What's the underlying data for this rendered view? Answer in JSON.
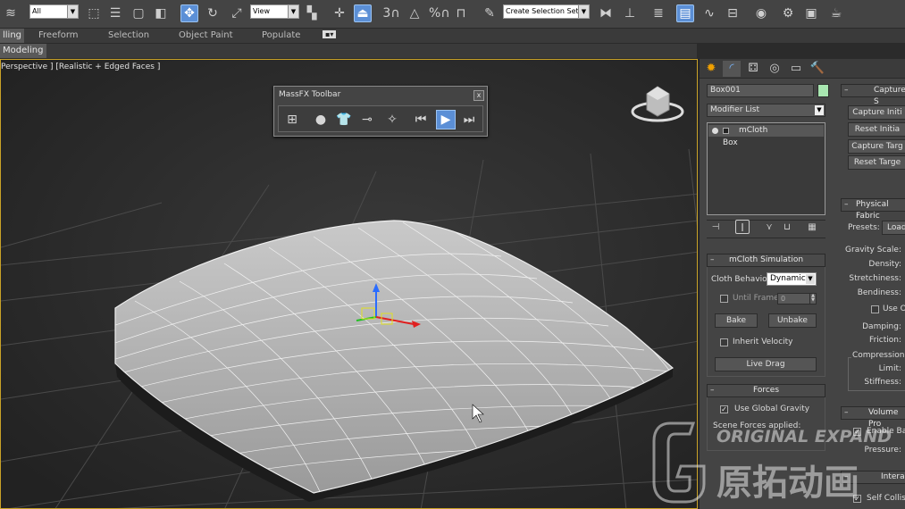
{
  "toolbar": {
    "selection_filter": "All",
    "reference_coord": "View",
    "named_selection_placeholder": "Create Selection Set",
    "snap_toggle_label": "3",
    "percent_snap_label": "%",
    "icons": [
      "undo-redo-icon",
      "select-object-icon",
      "select-by-name-icon",
      "rect-region-icon",
      "window-crossing-icon",
      "move-icon",
      "rotate-icon",
      "scale-icon",
      "select-manipulate-icon",
      "keyboard-shortcut-icon",
      "pivot-icon",
      "snap-icon",
      "angle-snap-icon",
      "percent-snap-icon",
      "spinner-snap-icon",
      "edit-named-selection-icon",
      "mirror-icon",
      "align-icon",
      "layer-manager-icon",
      "scene-explorer-icon",
      "curve-editor-icon",
      "schematic-view-icon",
      "material-editor-icon",
      "render-setup-icon",
      "rendered-frame-icon",
      "render-icon"
    ]
  },
  "ribbon": {
    "tabs": [
      "lling",
      "Freeform",
      "Selection",
      "Object Paint",
      "Populate"
    ],
    "sub_tab": "Modeling"
  },
  "viewport": {
    "label": "Perspective ] [Realistic + Edged Faces ]"
  },
  "massfx": {
    "title": "MassFX Toolbar",
    "close": "x",
    "buttons": [
      "world-params-icon",
      "rigid-body-icon",
      "mcloth-icon",
      "constraint-icon",
      "ragdoll-icon",
      "reset-simulation-icon",
      "play-simulation-icon",
      "step-simulation-icon"
    ]
  },
  "command_panel": {
    "tabs": [
      "create-icon",
      "modify-icon",
      "hierarchy-icon",
      "motion-icon",
      "display-icon",
      "utilities-icon"
    ],
    "object_name": "Box001",
    "object_color": "#a8e6b0",
    "modifier_list": "Modifier List",
    "stack": [
      "mCloth",
      "Box"
    ],
    "mcloth_simulation": {
      "title": "mCloth Simulation",
      "cloth_behavior_label": "Cloth Behavior:",
      "cloth_behavior_value": "Dynamic",
      "until_frame_label": "Until Frame",
      "until_frame_value": "0",
      "bake": "Bake",
      "unbake": "Unbake",
      "inherit_velocity": "Inherit Velocity",
      "live_drag": "Live Drag"
    },
    "forces": {
      "title": "Forces",
      "use_global_gravity": "Use Global Gravity",
      "scene_forces_applied": "Scene Forces applied:"
    },
    "capture": {
      "title": "Capture S",
      "buttons": [
        "Capture Initi",
        "Reset Initia",
        "Capture Targ",
        "Reset Targe"
      ]
    },
    "physical_fabric": {
      "title": "Physical Fabric",
      "presets_label": "Presets:",
      "presets_button": "Load",
      "rows": [
        "Gravity Scale:",
        "Density:",
        "Stretchiness:",
        "Bendiness:"
      ],
      "use_label": "Use Or",
      "rows2": [
        "Damping:",
        "Friction:"
      ],
      "compression_group": "Compression",
      "rows3": [
        "Limit:",
        "Stiffness:"
      ]
    },
    "volume": {
      "title": "Volume Pro",
      "enable_label": "Enable Ball",
      "pressure_label": "Pressure:"
    },
    "interaction": {
      "title": "Interac",
      "self_collision": "Self Collisi"
    }
  },
  "watermark": {
    "en": "ORIGINAL EXPAND",
    "cn": "原拓动画"
  }
}
